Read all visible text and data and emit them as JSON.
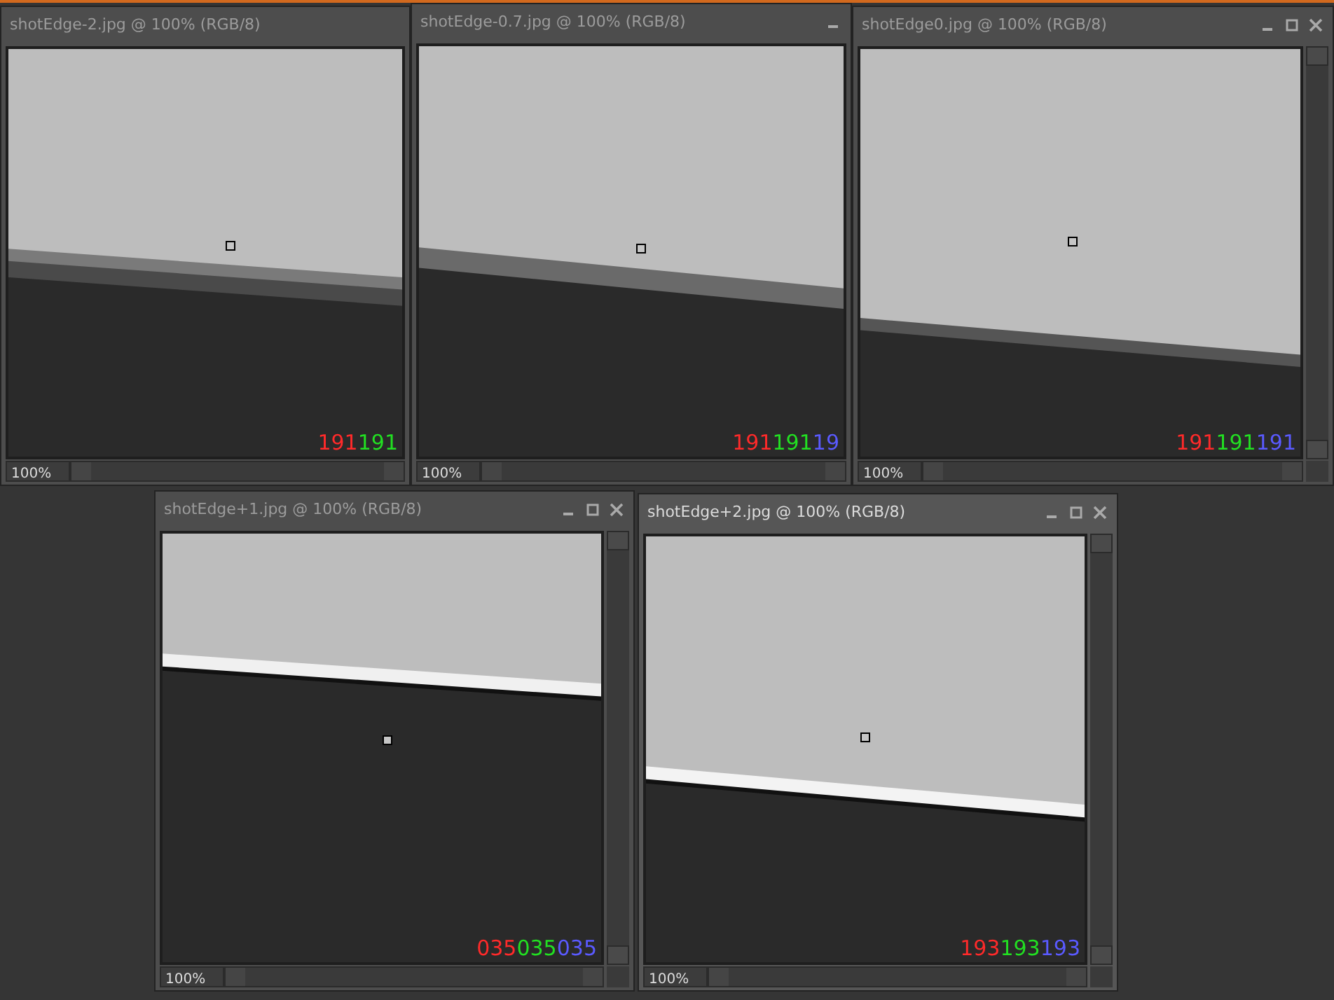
{
  "windows": [
    {
      "title": "shotEdge-2.jpg @ 100% (RGB/8)",
      "active": false,
      "vertical_scrollbar": false,
      "readout": [
        "191",
        "191"
      ],
      "zoom": "100%"
    },
    {
      "title": "shotEdge-0.7.jpg @ 100% (RGB/8)",
      "active": false,
      "controls": [
        {
          "kind": "minimize"
        }
      ],
      "vertical_scrollbar": false,
      "readout": [
        "191",
        "191",
        "19"
      ],
      "zoom": "100%"
    },
    {
      "title": "shotEdge0.jpg @ 100% (RGB/8)",
      "active": false,
      "controls": [
        {
          "kind": "minimize"
        },
        {
          "kind": "maximize"
        },
        {
          "kind": "close"
        }
      ],
      "vertical_scrollbar": true,
      "readout": [
        "191",
        "191",
        "191"
      ],
      "zoom": "100%"
    },
    {
      "title": "shotEdge+1.jpg @ 100% (RGB/8)",
      "active": false,
      "controls": [
        {
          "kind": "minimize"
        },
        {
          "kind": "maximize"
        },
        {
          "kind": "close"
        }
      ],
      "vertical_scrollbar": true,
      "readout": [
        "035",
        "035",
        "035"
      ],
      "zoom": "100%"
    },
    {
      "title": "shotEdge+2.jpg @ 100% (RGB/8)",
      "active": true,
      "controls": [
        {
          "kind": "minimize"
        },
        {
          "kind": "maximize"
        },
        {
          "kind": "close"
        }
      ],
      "vertical_scrollbar": true,
      "readout": [
        "193",
        "193",
        "193"
      ],
      "zoom": "100%"
    }
  ]
}
